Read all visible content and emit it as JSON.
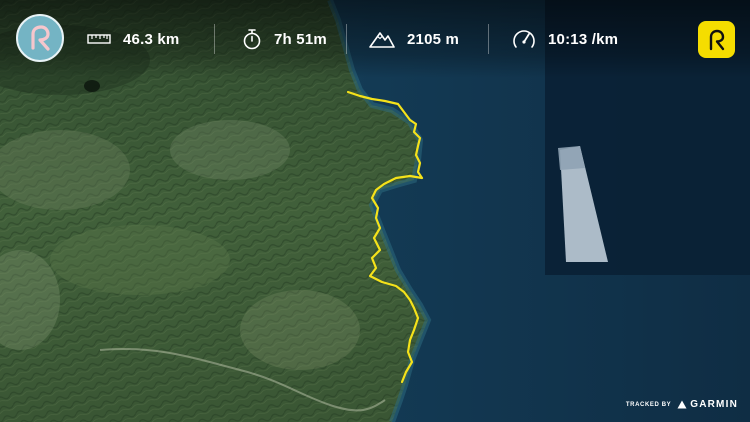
{
  "stats": {
    "distance": "46.3 km",
    "duration": "7h 51m",
    "elevation": "2105 m",
    "pace": "10:13 /km"
  },
  "icons": {
    "app_logo": "relive-logo-icon",
    "distance": "ruler-icon",
    "duration": "stopwatch-icon",
    "elevation": "mountain-icon",
    "pace": "speedometer-icon",
    "app_button": "relive-logo-icon"
  },
  "credit": {
    "label": "TRACKED BY",
    "brand": "GARMIN"
  },
  "colors": {
    "route": "#f5e21a",
    "app_button": "#f5dd00",
    "logo_circle": "#74b4c4",
    "logo_mark": "#f6c6cc",
    "sea": "#123a52",
    "land": "#3c5a34"
  }
}
